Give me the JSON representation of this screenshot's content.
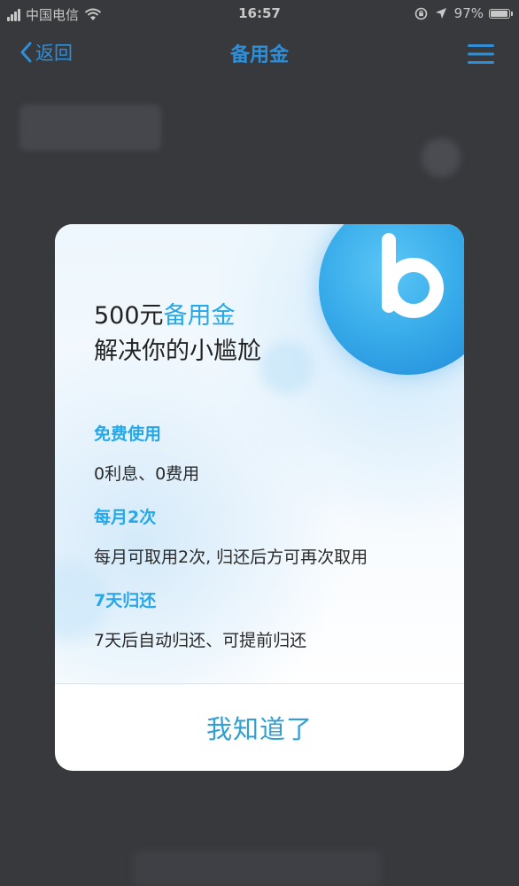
{
  "status_bar": {
    "carrier": "中国电信",
    "time": "16:57",
    "battery": "97%",
    "battery_level": 0.97,
    "icons": [
      "signal-icon",
      "wifi-icon",
      "orientation-lock-icon",
      "location-icon",
      "battery-icon"
    ]
  },
  "nav": {
    "back_label": "返回",
    "title": "备用金",
    "icons": [
      "chevron-left-icon",
      "menu-icon"
    ]
  },
  "modal": {
    "headline_amount": "500元",
    "headline_accent": "备用金",
    "headline_line2": "解决你的小尴尬",
    "sections": [
      {
        "title": "免费使用",
        "desc": "0利息、0费用"
      },
      {
        "title": "每月2次",
        "desc": "每月可取用2次, 归还后方可再次取用"
      },
      {
        "title": "7天归还",
        "desc": "7天后自动归还、可提前归还"
      }
    ],
    "button_label": "我知道了",
    "logo_icon": "b-logo-icon"
  },
  "colors": {
    "accent": "#26a8e8",
    "nav_blue": "#2e8fd8",
    "overlay_bg": "#38393d",
    "button_text": "#2f9fd6"
  }
}
